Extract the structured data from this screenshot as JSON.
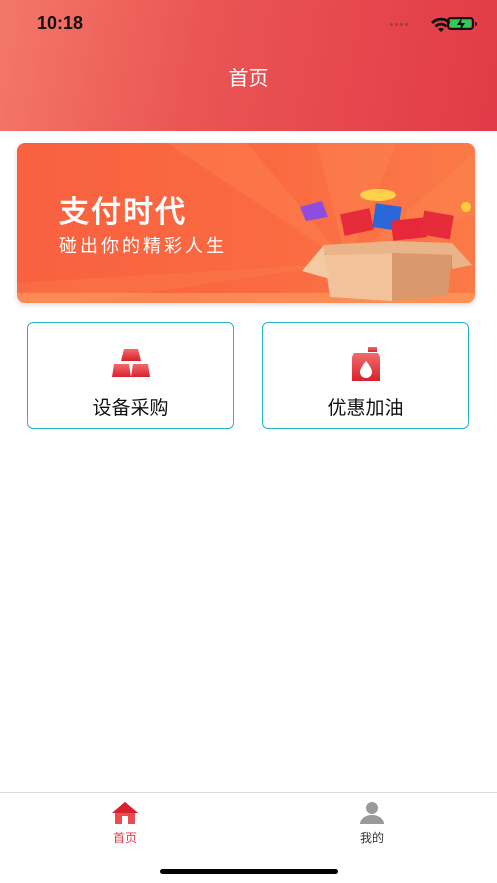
{
  "status_bar": {
    "time": "10:18",
    "battery_color": "#34c759"
  },
  "header": {
    "title": "首页",
    "gradient": [
      "#f4776a",
      "#e23a48"
    ]
  },
  "banner": {
    "title": "支付时代",
    "subtitle": "碰出你的精彩人生",
    "background": "#f9613f"
  },
  "cards": [
    {
      "label": "设备采购",
      "icon": "gold-bars-icon"
    },
    {
      "label": "优惠加油",
      "icon": "fuel-can-icon"
    }
  ],
  "card_border_color": "#26b3c4",
  "tabbar": {
    "items": [
      {
        "label": "首页",
        "icon": "home-icon",
        "active": true,
        "color": "#e23a48"
      },
      {
        "label": "我的",
        "icon": "user-icon",
        "active": false,
        "color": "#333333"
      }
    ]
  }
}
